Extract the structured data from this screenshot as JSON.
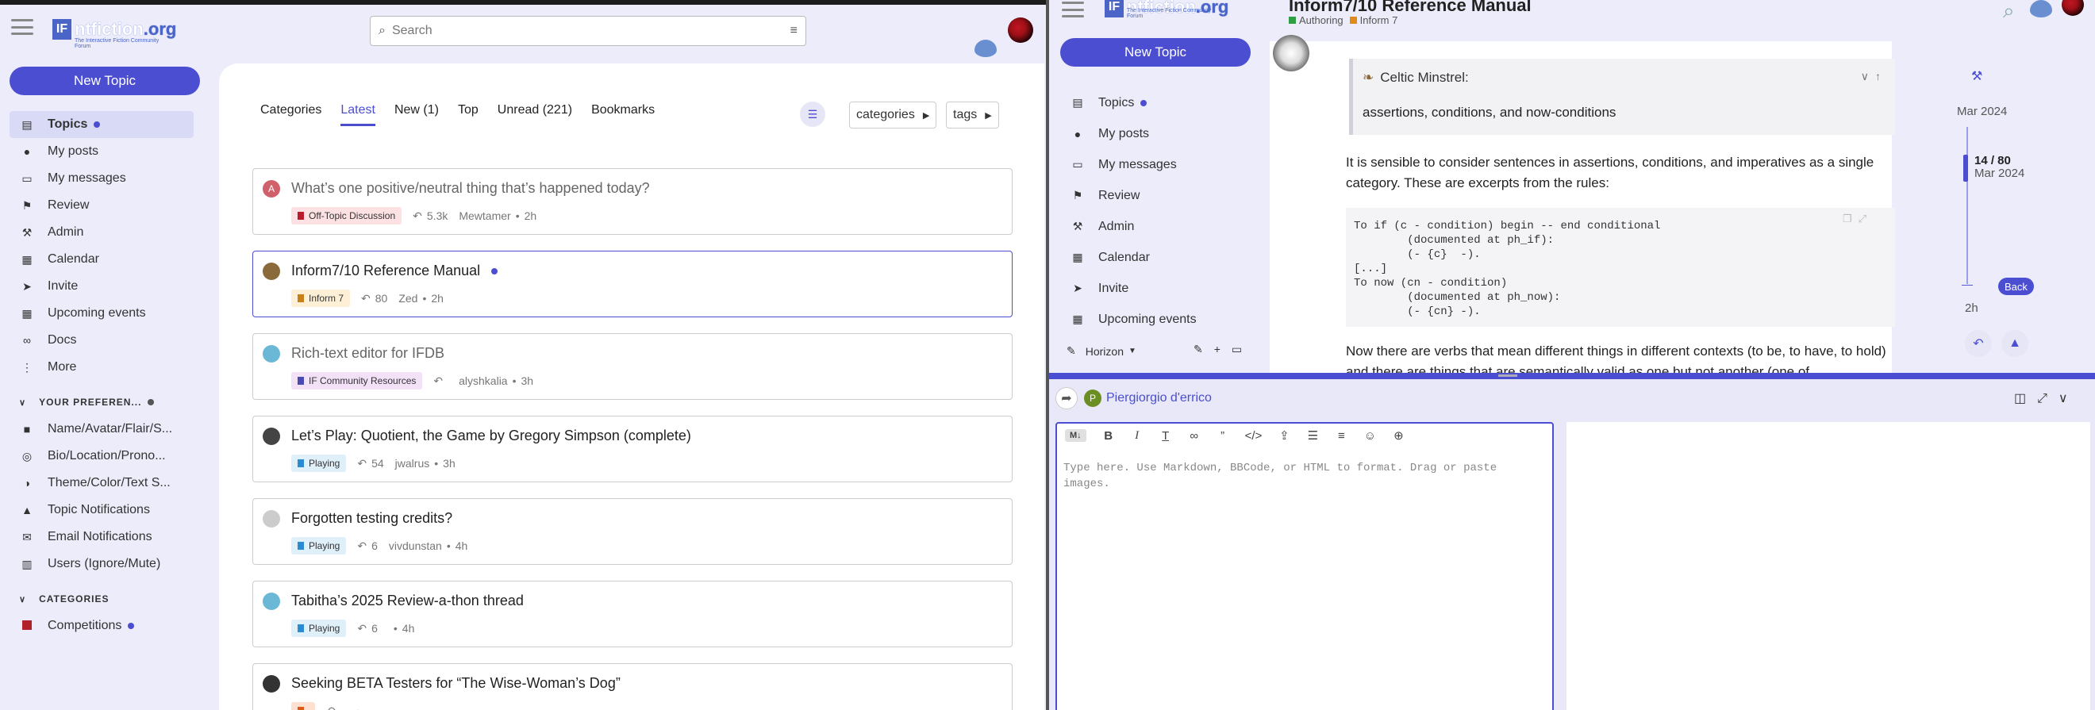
{
  "left": {
    "logo": {
      "mark": "IF",
      "name_a": "ntfiction",
      "name_b": ".org",
      "subtitle": "The Interactive Fiction Community Forum"
    },
    "search": {
      "placeholder": "Search"
    },
    "new_topic": "New Topic",
    "sidebar": {
      "items": [
        {
          "label": "Topics",
          "icon": "layers-icon",
          "active": true,
          "dot": true
        },
        {
          "label": "My posts",
          "icon": "user-icon"
        },
        {
          "label": "My messages",
          "icon": "inbox-icon"
        },
        {
          "label": "Review",
          "icon": "flag-icon"
        },
        {
          "label": "Admin",
          "icon": "wrench-icon"
        },
        {
          "label": "Calendar",
          "icon": "calendar-icon"
        },
        {
          "label": "Invite",
          "icon": "paper-plane-icon"
        },
        {
          "label": "Upcoming events",
          "icon": "calendar-icon"
        },
        {
          "label": "Docs",
          "icon": "link-icon"
        },
        {
          "label": "More",
          "icon": "dots-icon"
        }
      ],
      "pref_header": "YOUR PREFEREN...",
      "prefs": [
        {
          "label": "Name/Avatar/Flair/S...",
          "icon": "id-card-icon"
        },
        {
          "label": "Bio/Location/Prono...",
          "icon": "globe-icon"
        },
        {
          "label": "Theme/Color/Text S...",
          "icon": "palette-icon"
        },
        {
          "label": "Topic Notifications",
          "icon": "bell-icon"
        },
        {
          "label": "Email Notifications",
          "icon": "envelope-icon"
        },
        {
          "label": "Users (Ignore/Mute)",
          "icon": "user-slash-icon"
        }
      ],
      "cat_header": "CATEGORIES",
      "cats": [
        {
          "label": "Competitions",
          "color": "#b0212a",
          "dot": true
        }
      ]
    },
    "tabs": [
      "Categories",
      "Latest",
      "New (1)",
      "Top",
      "Unread (221)",
      "Bookmarks"
    ],
    "active_tab": "Latest",
    "filters": {
      "categories": "categories",
      "tags": "tags"
    },
    "topics": [
      {
        "title": "What’s one positive/neutral thing that’s happened today?",
        "avatar": "A",
        "avatar_color": "#d0606a",
        "category": "Off-Topic Discussion",
        "cat_color": "#b81c2d",
        "cat_bg": "#fde1e3",
        "replies": "5.3k",
        "user": "Mewtamer",
        "age": "2h",
        "read": true
      },
      {
        "title": "Inform7/10 Reference Manual",
        "avatar": "",
        "avatar_color": "#8a6a3a",
        "category": "Inform 7",
        "cat_color": "#c8801a",
        "cat_bg": "#fdf0d6",
        "replies": "80",
        "user": "Zed",
        "age": "2h",
        "selected": true,
        "unread_dot": true
      },
      {
        "title": "Rich-text editor for IFDB",
        "avatar": "",
        "avatar_color": "#6bb7d6",
        "category": "IF Community Resources",
        "cat_color": "#4a4ab0",
        "cat_bg": "#f3e2f7",
        "replies": "",
        "user": "alyshkalia",
        "age": "3h",
        "read": true
      },
      {
        "title": "Let’s Play: Quotient, the Game by Gregory Simpson (complete)",
        "avatar": "",
        "avatar_color": "#444444",
        "category": "Playing",
        "cat_color": "#2c8ad0",
        "cat_bg": "#dff0fb",
        "replies": "54",
        "user": "jwalrus",
        "age": "3h"
      },
      {
        "title": "Forgotten testing credits?",
        "avatar": "",
        "avatar_color": "#cccccc",
        "category": "Playing",
        "cat_color": "#2c8ad0",
        "cat_bg": "#dff0fb",
        "replies": "6",
        "user": "vivdunstan",
        "age": "4h"
      },
      {
        "title": "Tabitha’s 2025 Review-a-thon thread",
        "avatar": "",
        "avatar_color": "#6bb7d6",
        "category": "Playing",
        "cat_color": "#2c8ad0",
        "cat_bg": "#dff0fb",
        "replies": "6",
        "user": "",
        "age": "4h"
      },
      {
        "title": "Seeking BETA Testers for “The Wise-Woman’s Dog”",
        "avatar": "",
        "avatar_color": "#333333",
        "category": "",
        "cat_color": "#e05a1a",
        "cat_bg": "#fde0d0",
        "replies": "",
        "user": "",
        "age": ""
      }
    ]
  },
  "right": {
    "logo": {
      "mark": "IF",
      "name_a": "ntfiction",
      "name_b": ".org",
      "subtitle": "The Interactive Fiction Community Forum"
    },
    "topic_title": "Inform7/10 Reference Manual",
    "crumbs": [
      {
        "label": "Authoring",
        "color": "#2ea043"
      },
      {
        "label": "Inform 7",
        "color": "#e08a1a"
      }
    ],
    "new_topic": "New Topic",
    "sidebar": [
      {
        "label": "Topics",
        "icon": "layers-icon",
        "dot": true
      },
      {
        "label": "My posts",
        "icon": "user-icon"
      },
      {
        "label": "My messages",
        "icon": "inbox-icon"
      },
      {
        "label": "Review",
        "icon": "flag-icon"
      },
      {
        "label": "Admin",
        "icon": "wrench-icon"
      },
      {
        "label": "Calendar",
        "icon": "calendar-icon"
      },
      {
        "label": "Invite",
        "icon": "paper-plane-icon"
      },
      {
        "label": "Upcoming events",
        "icon": "calendar-icon"
      }
    ],
    "theme": "Horizon",
    "quote_author": "Celtic Minstrel:",
    "quote_text": "assertions, conditions, and now-conditions",
    "para1": "It is sensible to consider sentences in assertions, conditions, and imperatives as a single category. These are excerpts from the rules:",
    "code": "To if (c - condition) begin -- end conditional\n        (documented at ph_if):\n        (- {c}  -).\n[...]\nTo now (cn - condition)\n        (documented at ph_now):\n        (- {cn} -).",
    "para2": "Now there are verbs that mean different things in different contexts (to be, to have, to hold) and there are things that are semantically valid as one but not another (one of",
    "timeline": {
      "start": "Mar 2024",
      "progress": "14 / 80",
      "progress_date": "Mar 2024",
      "end": "2h",
      "back": "Back",
      "fraction": 0.175
    },
    "composer": {
      "reply_to": "Piergiorgio d'errico",
      "avatar_letter": "P",
      "avatar_color": "#6b8e23",
      "placeholder": "Type here. Use Markdown, BBCode, or HTML to format. Drag or paste images."
    }
  }
}
